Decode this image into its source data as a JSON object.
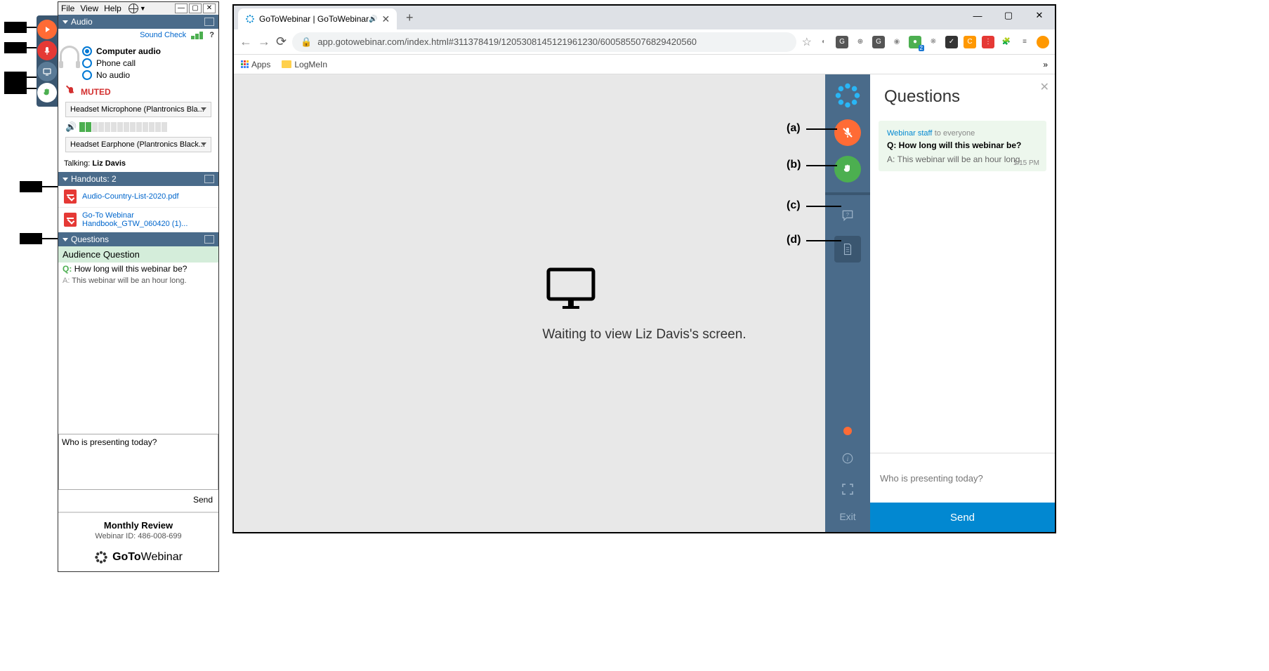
{
  "controlPanel": {
    "menu": {
      "file": "File",
      "view": "View",
      "help": "Help"
    },
    "sections": {
      "audio": {
        "title": "Audio",
        "soundCheck": "Sound Check",
        "options": {
          "computer": "Computer audio",
          "phone": "Phone call",
          "none": "No audio"
        },
        "mutedLabel": "MUTED",
        "micDevice": "Headset Microphone (Plantronics Bla...",
        "spkDevice": "Headset Earphone (Plantronics Black...",
        "talkingLabel": "Talking:",
        "talkingName": "Liz Davis"
      },
      "handouts": {
        "title": "Handouts: 2",
        "items": [
          {
            "name": "Audio-Country-List-2020.pdf"
          },
          {
            "name": "Go-To Webinar Handbook_GTW_060420 (1)..."
          }
        ]
      },
      "questions": {
        "title": "Questions",
        "audienceHeader": "Audience Question",
        "q": "How long will this webinar be?",
        "a": "This webinar will be an hour long.",
        "draft": "Who is presenting today?",
        "sendLabel": "Send"
      }
    },
    "footer": {
      "title": "Monthly Review",
      "id": "Webinar ID: 486-008-699",
      "brand1": "GoTo",
      "brand2": "Webinar"
    }
  },
  "browser": {
    "tabTitle": "GoToWebinar | GoToWebinar",
    "url": "app.gotowebinar.com/index.html#311378419/1205308145121961230/6005855076829420560",
    "bookmarks": {
      "apps": "Apps",
      "logmein": "LogMeIn"
    },
    "waitingText": "Waiting to view Liz Davis's screen.",
    "exitLabel": "Exit"
  },
  "questionsPanel": {
    "title": "Questions",
    "sender": "Webinar staff",
    "to": "to everyone",
    "q": "How long will this webinar be?",
    "a": "This webinar will be an hour long.",
    "time": "1:15 PM",
    "inputPlaceholder": "Who is presenting today?",
    "sendLabel": "Send"
  },
  "annotations": {
    "a": "(a)",
    "b": "(b)",
    "c": "(c)",
    "d": "(d)"
  }
}
